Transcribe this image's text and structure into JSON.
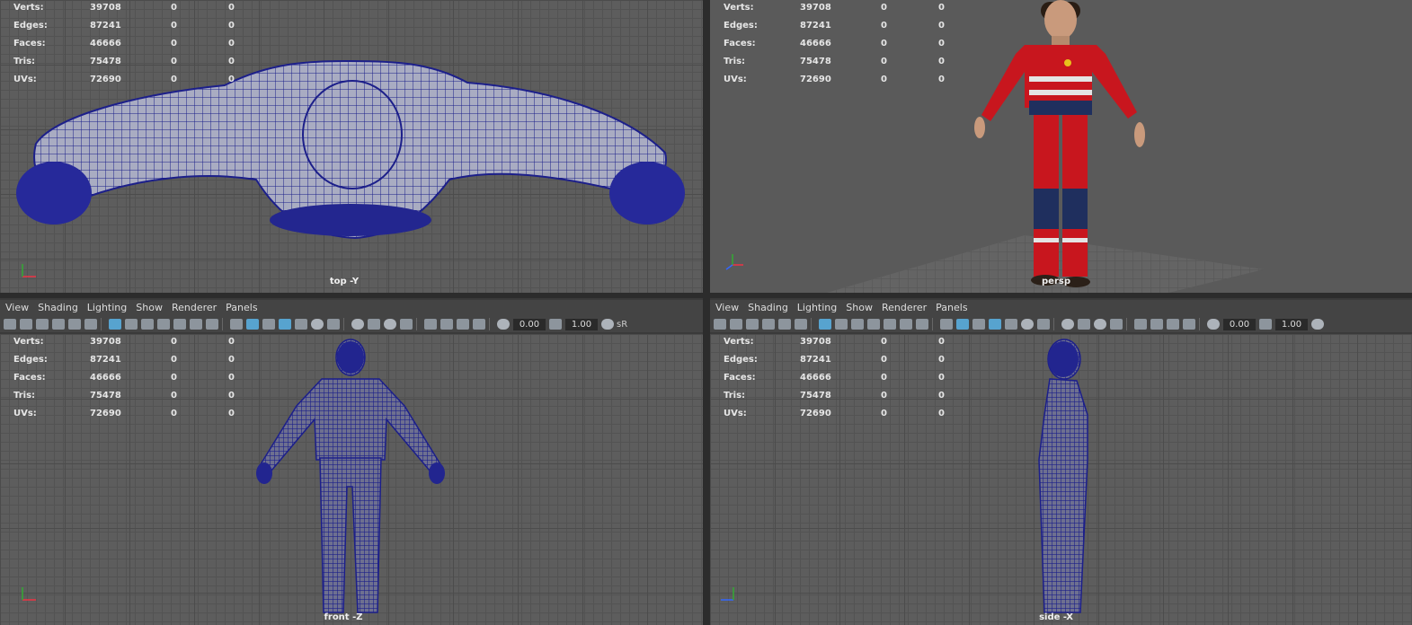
{
  "stats": {
    "labels": [
      "Verts:",
      "Edges:",
      "Faces:",
      "Tris:",
      "UVs:"
    ],
    "values": [
      "39708",
      "87241",
      "46666",
      "75478",
      "72690"
    ],
    "zero": "0"
  },
  "viewports": {
    "top": {
      "camera": "top -Y"
    },
    "persp": {
      "camera": "persp"
    },
    "front": {
      "camera": "front -Z"
    },
    "side": {
      "camera": "side -X"
    }
  },
  "panel_menu": [
    "View",
    "Shading",
    "Lighting",
    "Show",
    "Renderer",
    "Panels"
  ],
  "toolbar": {
    "exposure": "0.00",
    "gamma": "1.00",
    "srgb_label": "sR"
  },
  "colors": {
    "wire": "#1c1f8a",
    "suit_red": "#c8161e",
    "suit_navy": "#1f2f5e",
    "grid": "#5d5d5d"
  }
}
